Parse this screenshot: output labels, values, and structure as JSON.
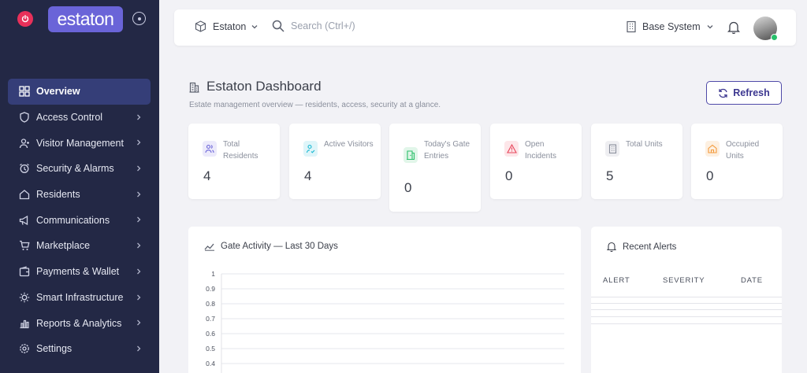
{
  "sidebar": {
    "logo_text": "estaton",
    "items": [
      {
        "label": "Overview",
        "icon": "grid-icon",
        "active": true
      },
      {
        "label": "Access Control",
        "icon": "shield-icon"
      },
      {
        "label": "Visitor Management",
        "icon": "user-plus-icon"
      },
      {
        "label": "Security & Alarms",
        "icon": "alarm-clock-icon"
      },
      {
        "label": "Residents",
        "icon": "home-icon"
      },
      {
        "label": "Communications",
        "icon": "megaphone-icon"
      },
      {
        "label": "Marketplace",
        "icon": "cart-icon"
      },
      {
        "label": "Payments & Wallet",
        "icon": "wallet-icon"
      },
      {
        "label": "Smart Infrastructure",
        "icon": "sun-icon"
      },
      {
        "label": "Reports & Analytics",
        "icon": "bar-chart-icon"
      },
      {
        "label": "Settings",
        "icon": "gear-icon"
      }
    ]
  },
  "topbar": {
    "estate_name": "Estaton",
    "search_placeholder": "Search (Ctrl+/)",
    "system_name": "Base System"
  },
  "header": {
    "title": "Estaton Dashboard",
    "subtitle": "Estate management overview — residents, access, security at a glance.",
    "refresh_label": "Refresh"
  },
  "stats": [
    {
      "label": "Total Residents",
      "value": "4",
      "icon": "users-icon",
      "color": "#6a64d8"
    },
    {
      "label": "Active Visitors",
      "value": "4",
      "icon": "user-check-icon",
      "color": "#17b8d2"
    },
    {
      "label": "Today's Gate Entries",
      "value": "0",
      "icon": "door-icon",
      "color": "#2bbf6a"
    },
    {
      "label": "Open Incidents",
      "value": "0",
      "icon": "warning-icon",
      "color": "#e8455a"
    },
    {
      "label": "Total Units",
      "value": "5",
      "icon": "building-icon",
      "color": "#8a8f9c"
    },
    {
      "label": "Occupied Units",
      "value": "0",
      "icon": "house-icon",
      "color": "#f39a3c"
    }
  ],
  "gate_panel": {
    "title": "Gate Activity — Last 30 Days"
  },
  "chart_data": {
    "type": "line",
    "title": "Gate Activity — Last 30 Days",
    "series": [],
    "xlabel": "",
    "ylabel": "",
    "ylim": [
      0,
      1
    ],
    "y_ticks": [
      "1",
      "0.9",
      "0.8",
      "0.7",
      "0.6",
      "0.5",
      "0.4"
    ],
    "grid": true
  },
  "alerts_panel": {
    "title": "Recent Alerts",
    "columns": [
      "ALERT",
      "SEVERITY",
      "DATE"
    ],
    "rows": []
  }
}
